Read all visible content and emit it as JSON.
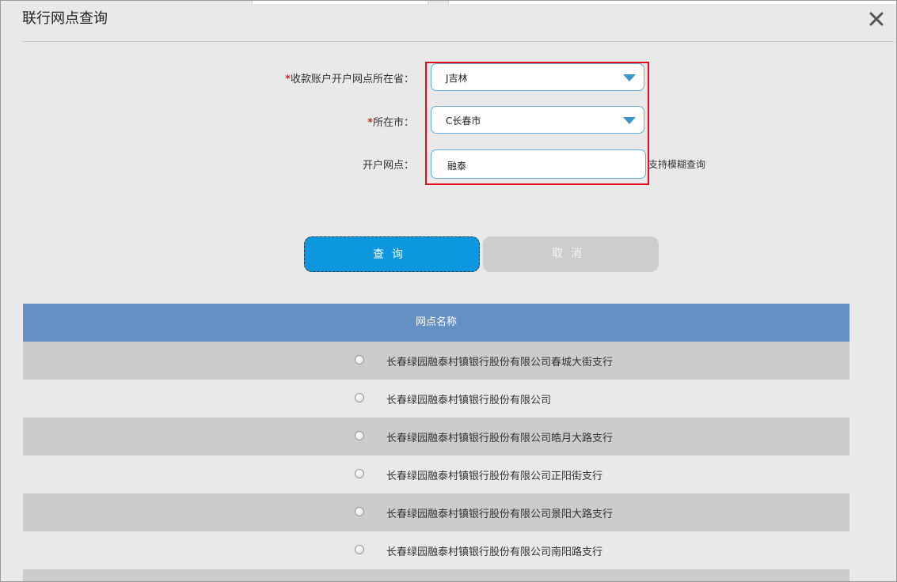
{
  "dialog": {
    "title": "联行网点查询",
    "close_icon": "close-icon"
  },
  "form": {
    "required_mark": "*",
    "province_label": "收款账户开户网点所在省：",
    "province_value": "J吉林",
    "city_label": "所在市：",
    "city_value": "C长春市",
    "branch_label": "开户网点：",
    "branch_value": "融泰",
    "fuzzy_hint": "支持模糊查询"
  },
  "buttons": {
    "query_label": "查询",
    "cancel_label": "取消"
  },
  "table": {
    "header": "网点名称",
    "rows": [
      "长春绿园融泰村镇银行股份有限公司春城大街支行",
      "长春绿园融泰村镇银行股份有限公司",
      "长春绿园融泰村镇银行股份有限公司皓月大路支行",
      "长春绿园融泰村镇银行股份有限公司正阳街支行",
      "长春绿园融泰村镇银行股份有限公司景阳大路支行",
      "长春绿园融泰村镇银行股份有限公司南阳路支行"
    ]
  },
  "colors": {
    "accent": "#0c97df",
    "table_header": "#6590c4",
    "highlight_box": "#e0101a"
  }
}
